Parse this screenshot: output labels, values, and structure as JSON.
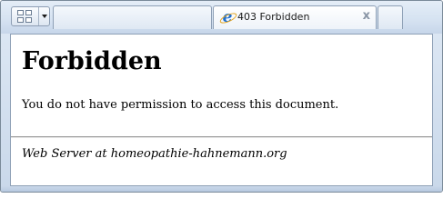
{
  "tabs": [
    {
      "label": ""
    },
    {
      "label": "403 Forbidden",
      "icon": "internet-explorer-icon",
      "close_glyph": "x"
    },
    {
      "label": ""
    }
  ],
  "toolbar": {
    "quick_tabs_icon": "quick-tabs-grid-icon",
    "tab_list_icon": "chevron-down-icon"
  },
  "page": {
    "title": "Forbidden",
    "message": "You do not have permission to access this document.",
    "server_signature": "Web Server at homeopathie-hahnemann.org"
  },
  "colors": {
    "frame": "#c9d8ea",
    "ie_blue": "#1e6fd0",
    "ie_ring": "#e3a521"
  }
}
